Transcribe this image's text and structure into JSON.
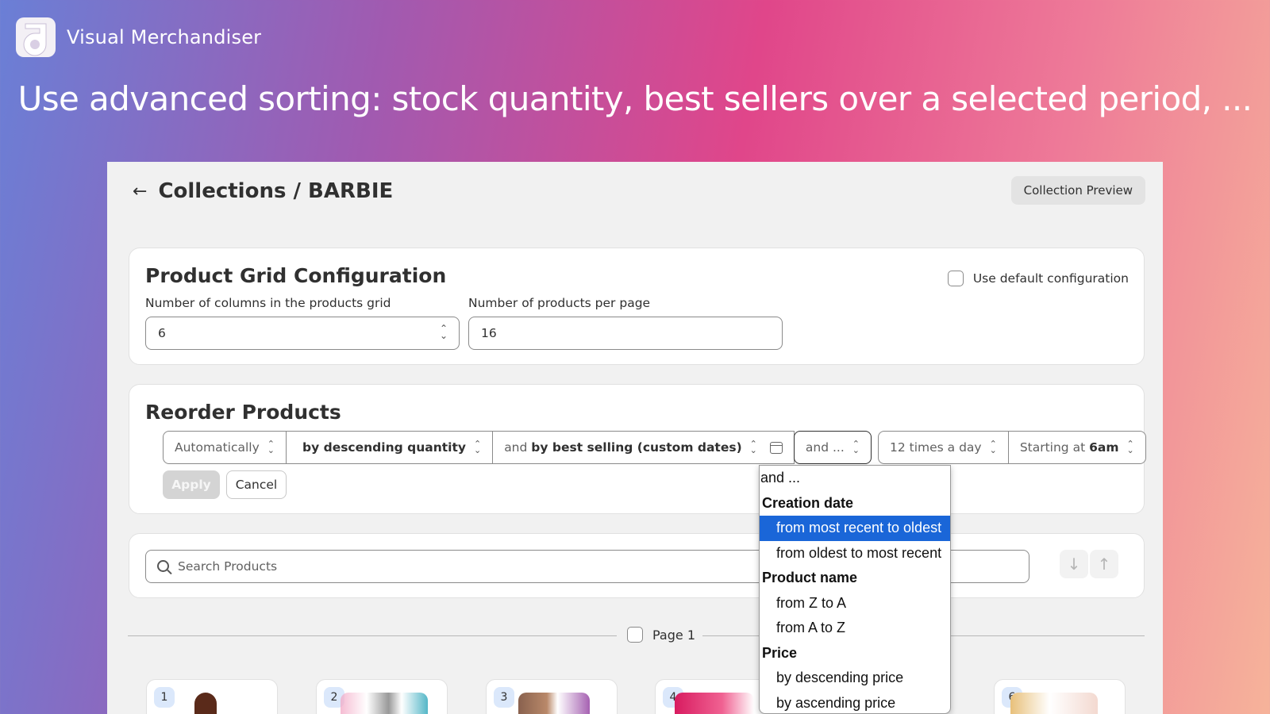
{
  "app": {
    "name": "Visual Merchandiser"
  },
  "headline": "Use advanced sorting: stock quantity, best sellers over a selected period, ...",
  "header": {
    "breadcrumb": "Collections / BARBIE",
    "preview_button": "Collection Preview"
  },
  "grid_config": {
    "title": "Product Grid Configuration",
    "default_label": "Use default configuration",
    "columns_label": "Number of columns in the products grid",
    "columns_value": "6",
    "per_page_label": "Number of products per page",
    "per_page_value": "16"
  },
  "reorder": {
    "title": "Reorder Products",
    "mode": "Automatically",
    "sort1": "by descending quantity",
    "sort2_prefix": "and",
    "sort2": "by best selling (custom dates)",
    "sort3": "and ...",
    "frequency": "12 times a day",
    "start_prefix": "Starting at",
    "start_value": "6am",
    "apply": "Apply",
    "cancel": "Cancel"
  },
  "search": {
    "placeholder": "Search Products"
  },
  "pagination": {
    "page_label": "Page 1"
  },
  "products": [
    "1",
    "2",
    "3",
    "4",
    "6"
  ],
  "dropdown": {
    "top": "and ...",
    "groups": [
      {
        "label": "Creation date",
        "options": [
          "from most recent to oldest",
          "from oldest to most recent"
        ]
      },
      {
        "label": "Product name",
        "options": [
          "from Z to A",
          "from A to Z"
        ]
      },
      {
        "label": "Price",
        "options": [
          "by descending price",
          "by ascending price"
        ]
      }
    ],
    "selected": "from most recent to oldest"
  },
  "colors": {
    "accent": "#1a66d8",
    "badge": "#dbe8fb"
  }
}
